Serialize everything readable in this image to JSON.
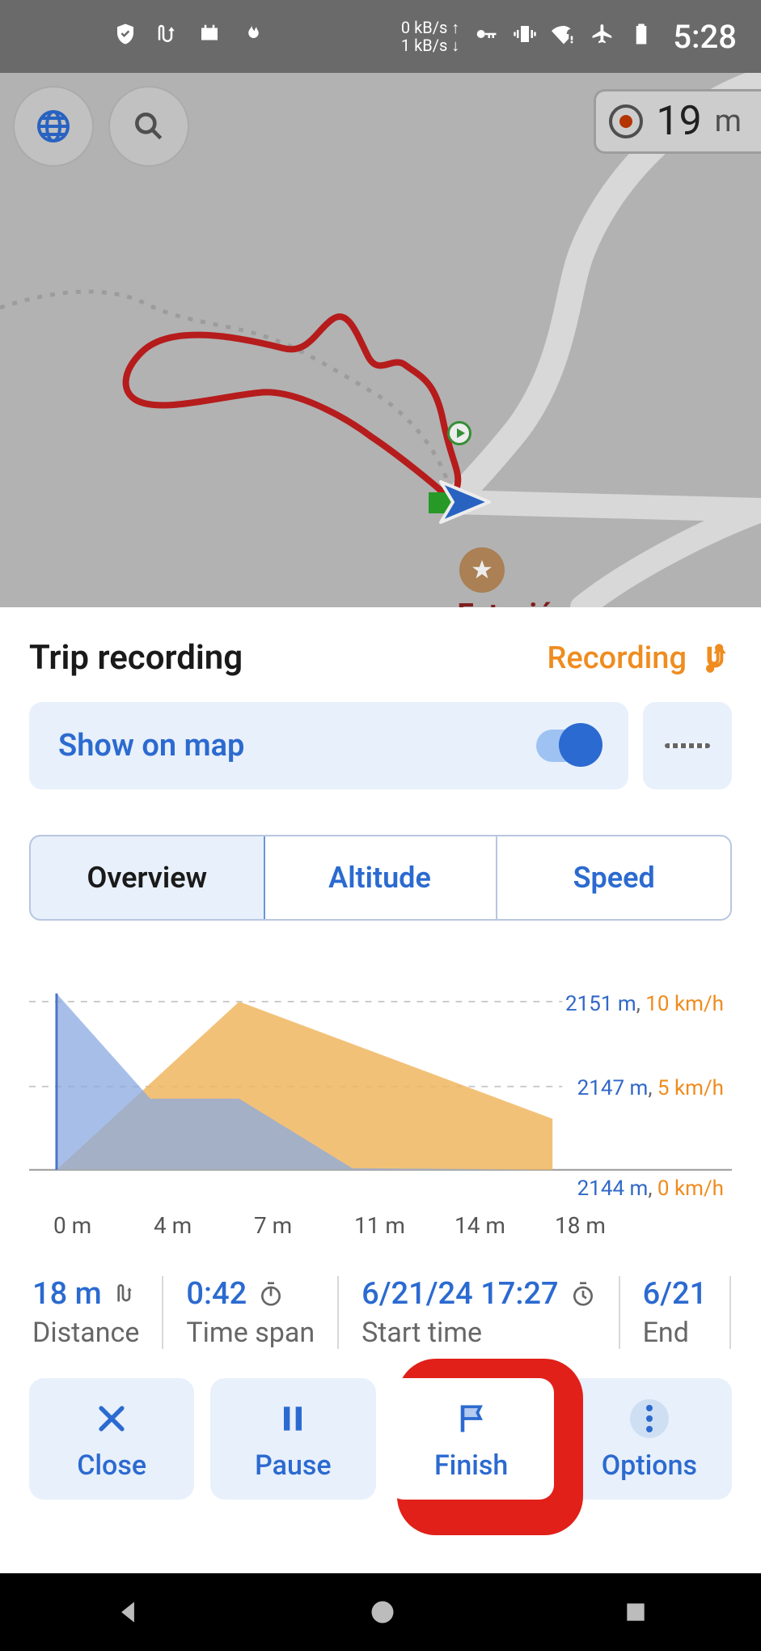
{
  "statusbar": {
    "net_up": "0 kB/s",
    "net_down": "1 kB/s",
    "clock": "5:28"
  },
  "map": {
    "zoom_value": "19",
    "zoom_unit": "m",
    "poi_label": "Estación biológica Yanavacu"
  },
  "panel": {
    "title": "Trip recording",
    "status_label": "Recording",
    "show_on_map_label": "Show on map",
    "tabs": [
      {
        "label": "Overview",
        "active": true
      },
      {
        "label": "Altitude",
        "active": false
      },
      {
        "label": "Speed",
        "active": false
      }
    ]
  },
  "chart_data": {
    "type": "area",
    "xlabel": "",
    "x_unit": "m",
    "x_ticks": [
      "0 m",
      "4 m",
      "7 m",
      "11 m",
      "14 m",
      "18 m"
    ],
    "gridlines": [
      {
        "altitude": "2151 m",
        "speed": "10 km/h"
      },
      {
        "altitude": "2147 m",
        "speed": "5 km/h"
      },
      {
        "altitude": "2144 m",
        "speed": "0 km/h"
      }
    ],
    "series": [
      {
        "name": "Altitude",
        "color": "#6a94e0",
        "unit": "m",
        "x": [
          0,
          4,
          7,
          11,
          18
        ],
        "values": [
          2151,
          2146,
          2146,
          2144,
          2144
        ]
      },
      {
        "name": "Speed",
        "color": "#f0a94a",
        "unit": "km/h",
        "x": [
          0,
          7,
          18
        ],
        "values": [
          0,
          10,
          3
        ]
      }
    ]
  },
  "stats": [
    {
      "value": "18 m",
      "label": "Distance",
      "icon": "route"
    },
    {
      "value": "0:42",
      "label": "Time span",
      "icon": "timer"
    },
    {
      "value": "6/21/24 17:27",
      "label": "Start time",
      "icon": "clock"
    },
    {
      "value": "6/21",
      "label": "End",
      "icon": ""
    }
  ],
  "actions": {
    "close": "Close",
    "pause": "Pause",
    "finish": "Finish",
    "options": "Options"
  }
}
